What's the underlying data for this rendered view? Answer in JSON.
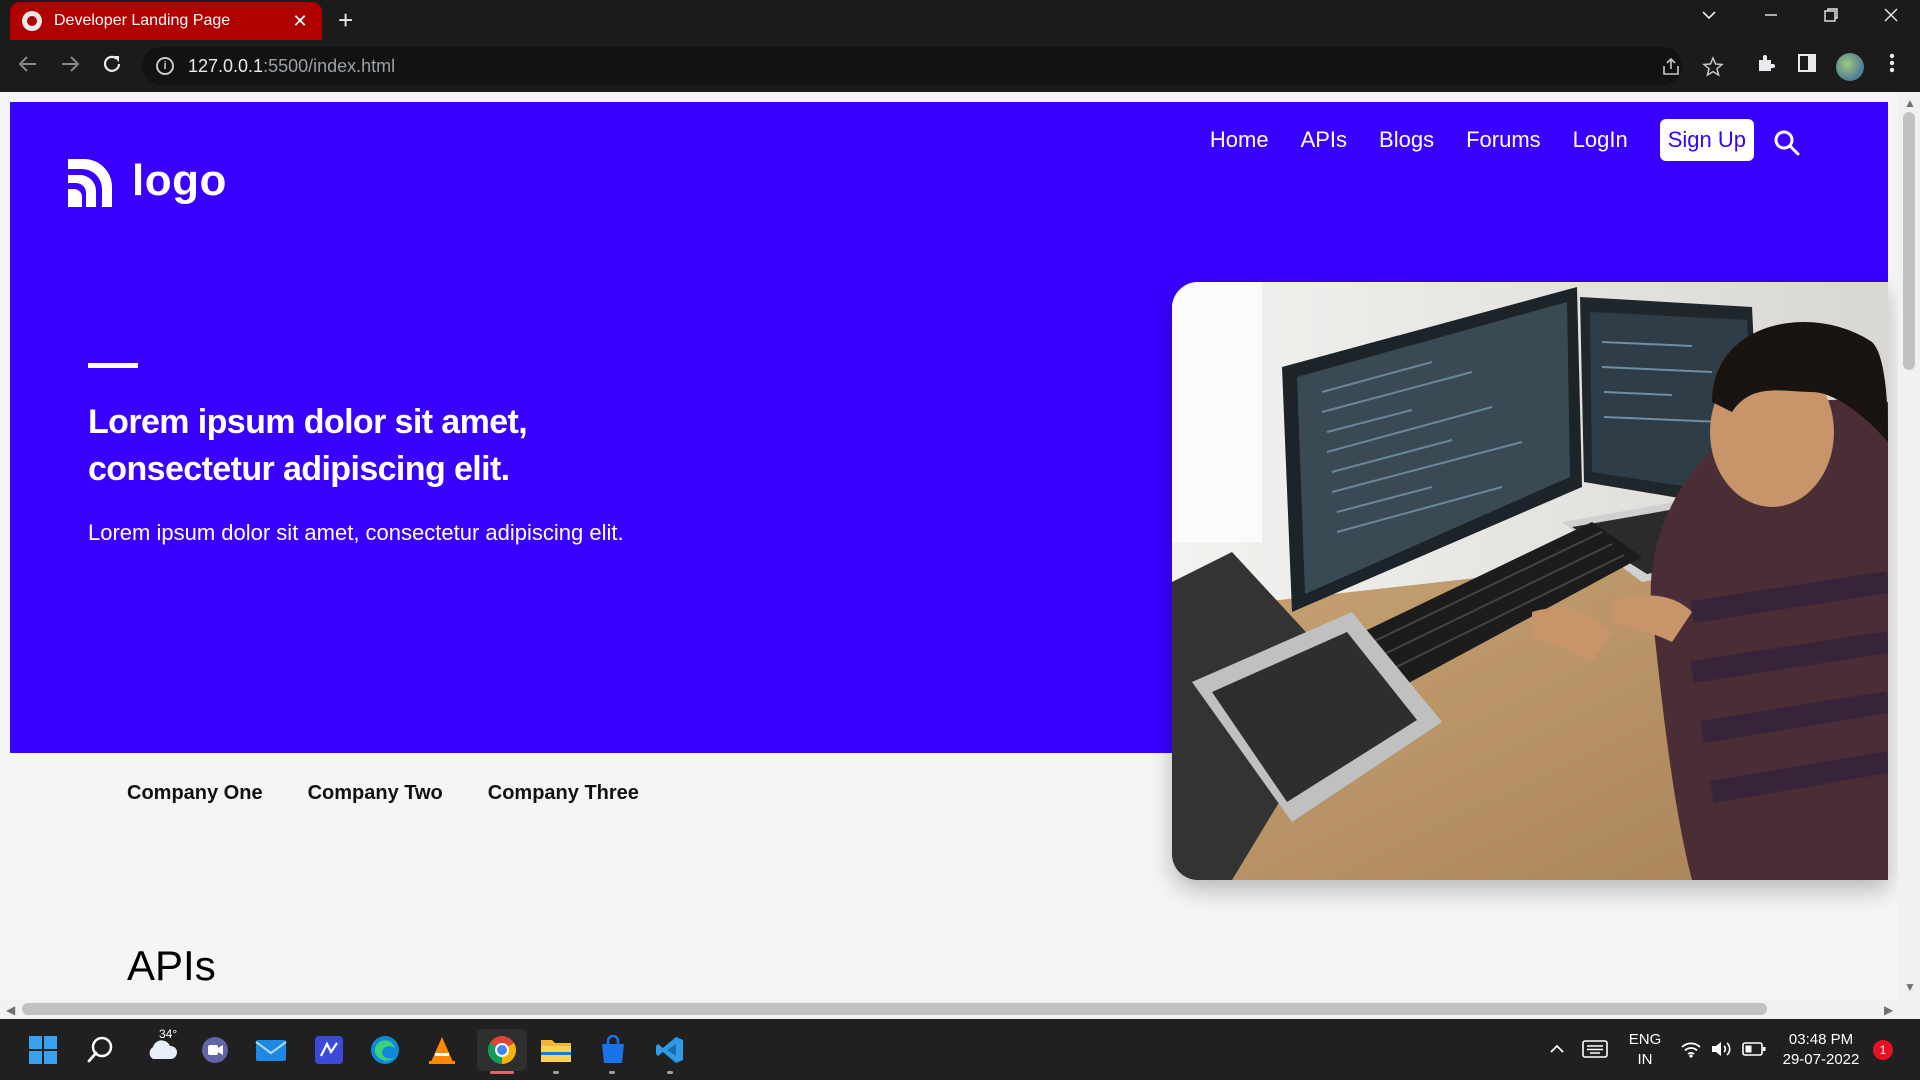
{
  "browser": {
    "tab_title": "Developer Landing Page",
    "tab_close": "✕",
    "new_tab": "+",
    "url_host": "127.0.0.1",
    "url_path": ":5500/index.html"
  },
  "page": {
    "logo_text": "logo",
    "nav": [
      "Home",
      "APIs",
      "Blogs",
      "Forums",
      "LogIn"
    ],
    "signup_label": "Sign Up",
    "headline": "Lorem ipsum dolor sit amet, consectetur adipiscing elit.",
    "subline": "Lorem ipsum dolor sit amet, consectetur adipiscing elit.",
    "companies": [
      "Company One",
      "Company Two",
      "Company Three"
    ],
    "section_title": "APIs",
    "accent_color": "#3a00ff"
  },
  "taskbar": {
    "weather_temp": "34°",
    "lang_line1": "ENG",
    "lang_line2": "IN",
    "time": "03:48 PM",
    "date": "29-07-2022",
    "notification_count": "1",
    "apps": [
      "start-icon",
      "search-icon",
      "weather-icon",
      "teams-icon",
      "mail-icon",
      "whiteboard-icon",
      "edge-icon",
      "vlc-icon",
      "chrome-icon",
      "file-explorer-icon",
      "store-icon",
      "vscode-icon"
    ]
  }
}
